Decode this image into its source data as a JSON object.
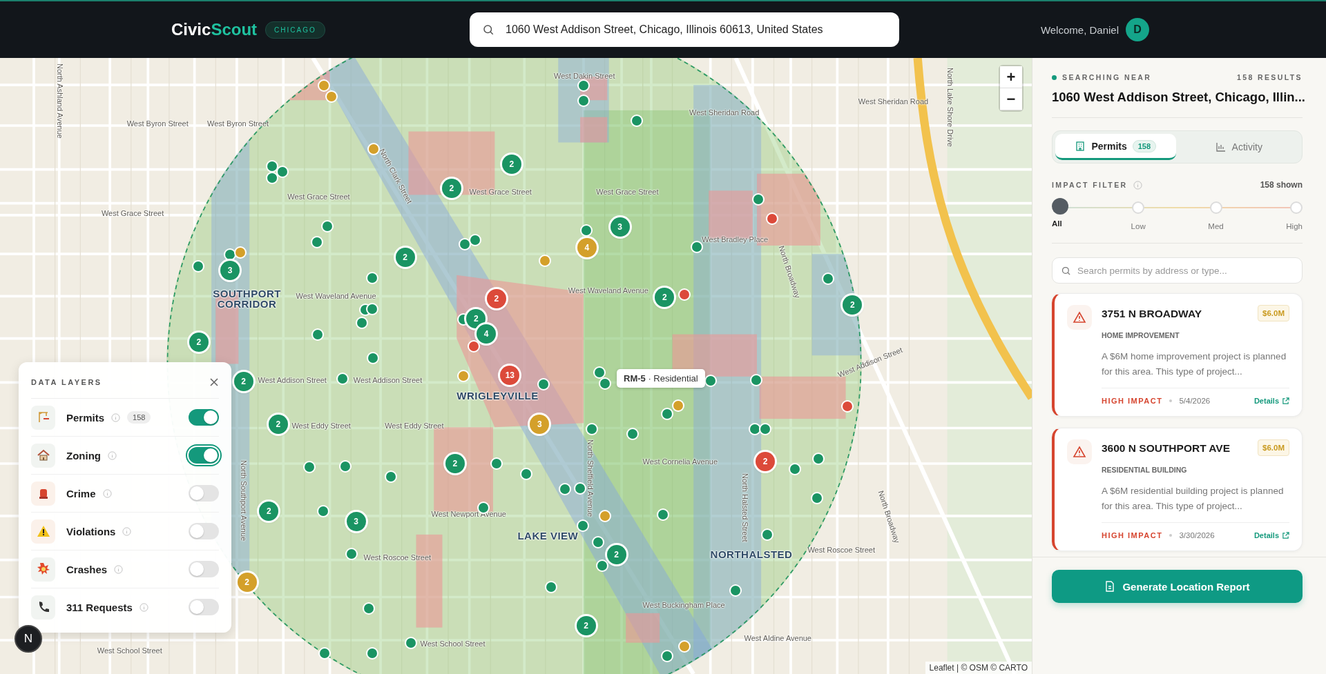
{
  "header": {
    "logo": [
      "Civic",
      "Scout"
    ],
    "city_badge": "CHICAGO",
    "search": {
      "value": "1060 West Addison Street, Chicago, Illinois 60613, United States"
    },
    "welcome": "Welcome, Daniel",
    "avatar": "D"
  },
  "map": {
    "labels": [
      {
        "text": "West Byron Street",
        "kind": "street"
      },
      {
        "text": "West Byron Street",
        "kind": "street"
      },
      {
        "text": "West Grace Street",
        "kind": "street"
      },
      {
        "text": "West Grace Street",
        "kind": "street"
      },
      {
        "text": "West Grace Street",
        "kind": "street"
      },
      {
        "text": "West Grace Street",
        "kind": "street"
      },
      {
        "text": "West Sheridan Road",
        "kind": "street"
      },
      {
        "text": "West Sheridan Road",
        "kind": "street"
      },
      {
        "text": "West Dakin Street",
        "kind": "street"
      },
      {
        "text": "West Waveland Avenue",
        "kind": "street"
      },
      {
        "text": "West Waveland Avenue",
        "kind": "street"
      },
      {
        "text": "West Addison Street",
        "kind": "street"
      },
      {
        "text": "West Addison Street",
        "kind": "street"
      },
      {
        "text": "West Addison Street",
        "kind": "street"
      },
      {
        "text": "West Eddy Street",
        "kind": "street"
      },
      {
        "text": "West Eddy Street",
        "kind": "street"
      },
      {
        "text": "West Cornelia Avenue",
        "kind": "street"
      },
      {
        "text": "West Newport Avenue",
        "kind": "street"
      },
      {
        "text": "West Roscoe Street",
        "kind": "street"
      },
      {
        "text": "West Roscoe Street",
        "kind": "street"
      },
      {
        "text": "West Buckingham Place",
        "kind": "street"
      },
      {
        "text": "West Aldine Avenue",
        "kind": "street"
      },
      {
        "text": "West School Street",
        "kind": "street"
      },
      {
        "text": "West School Street",
        "kind": "street"
      },
      {
        "text": "West Bradley Place",
        "kind": "street"
      },
      {
        "text": "SOUTHPORT CORRIDOR",
        "kind": "neighborhood"
      },
      {
        "text": "WRIGLEYVILLE",
        "kind": "neighborhood"
      },
      {
        "text": "LAKE VIEW",
        "kind": "neighborhood"
      },
      {
        "text": "NORTHALSTED",
        "kind": "neighborhood"
      },
      {
        "text": "North Ashland Avenue",
        "kind": "street"
      },
      {
        "text": "North Clark Street",
        "kind": "street"
      },
      {
        "text": "North Sheffield Avenue",
        "kind": "street"
      },
      {
        "text": "North Halsted Street",
        "kind": "street"
      },
      {
        "text": "North Broadway",
        "kind": "street"
      },
      {
        "text": "North Lake Shore Drive",
        "kind": "street"
      },
      {
        "text": "North Southport Avenue",
        "kind": "street"
      },
      {
        "text": "North Broadway",
        "kind": "street"
      }
    ],
    "markers": [
      {
        "count": "2",
        "color": "#1a9463"
      },
      {
        "count": "2",
        "color": "#1a9463"
      },
      {
        "count": "3",
        "color": "#1a9463"
      },
      {
        "count": "2",
        "color": "#1a9463"
      },
      {
        "count": "3",
        "color": "#1a9463"
      },
      {
        "count": "2",
        "color": "#1a9463"
      },
      {
        "count": "4",
        "color": "#1a9463"
      },
      {
        "count": "2",
        "color": "#1a9463"
      },
      {
        "count": "2",
        "color": "#1a9463"
      },
      {
        "count": "2",
        "color": "#1a9463"
      },
      {
        "count": "2",
        "color": "#1a9463"
      },
      {
        "count": "2",
        "color": "#1a9463"
      },
      {
        "count": "2",
        "color": "#1a9463"
      },
      {
        "count": "3",
        "color": "#1a9463"
      },
      {
        "count": "2",
        "color": "#1a9463"
      },
      {
        "count": "2",
        "color": "#1a9463"
      },
      {
        "count": "2",
        "color": "#1a9463"
      },
      {
        "count": "2",
        "color": "#dc4a3a"
      },
      {
        "count": "13",
        "color": "#dc4a3a"
      },
      {
        "count": "2",
        "color": "#dc4a3a"
      },
      {
        "count": "4",
        "color": "#d4a02a"
      },
      {
        "count": "3",
        "color": "#d4a02a"
      },
      {
        "count": "2",
        "color": "#d4a02a"
      }
    ],
    "dots": [
      {
        "color": "#1a9463"
      },
      {
        "color": "#1a9463"
      },
      {
        "color": "#1a9463"
      },
      {
        "color": "#1a9463"
      },
      {
        "color": "#1a9463"
      },
      {
        "color": "#1a9463"
      },
      {
        "color": "#1a9463"
      },
      {
        "color": "#1a9463"
      },
      {
        "color": "#1a9463"
      },
      {
        "color": "#1a9463"
      },
      {
        "color": "#1a9463"
      },
      {
        "color": "#1a9463"
      },
      {
        "color": "#1a9463"
      },
      {
        "color": "#1a9463"
      },
      {
        "color": "#1a9463"
      },
      {
        "color": "#1a9463"
      },
      {
        "color": "#1a9463"
      },
      {
        "color": "#1a9463"
      },
      {
        "color": "#1a9463"
      },
      {
        "color": "#1a9463"
      },
      {
        "color": "#1a9463"
      },
      {
        "color": "#1a9463"
      },
      {
        "color": "#1a9463"
      },
      {
        "color": "#1a9463"
      },
      {
        "color": "#1a9463"
      },
      {
        "color": "#1a9463"
      },
      {
        "color": "#1a9463"
      },
      {
        "color": "#1a9463"
      },
      {
        "color": "#1a9463"
      },
      {
        "color": "#1a9463"
      },
      {
        "color": "#1a9463"
      },
      {
        "color": "#1a9463"
      },
      {
        "color": "#1a9463"
      },
      {
        "color": "#1a9463"
      },
      {
        "color": "#1a9463"
      },
      {
        "color": "#1a9463"
      },
      {
        "color": "#1a9463"
      },
      {
        "color": "#1a9463"
      },
      {
        "color": "#1a9463"
      },
      {
        "color": "#1a9463"
      },
      {
        "color": "#1a9463"
      },
      {
        "color": "#1a9463"
      },
      {
        "color": "#1a9463"
      },
      {
        "color": "#1a9463"
      },
      {
        "color": "#1a9463"
      },
      {
        "color": "#1a9463"
      },
      {
        "color": "#1a9463"
      },
      {
        "color": "#1a9463"
      },
      {
        "color": "#1a9463"
      },
      {
        "color": "#1a9463"
      },
      {
        "color": "#1a9463"
      },
      {
        "color": "#1a9463"
      },
      {
        "color": "#1a9463"
      },
      {
        "color": "#1a9463"
      },
      {
        "color": "#1a9463"
      },
      {
        "color": "#1a9463"
      },
      {
        "color": "#1a9463"
      },
      {
        "color": "#1a9463"
      },
      {
        "color": "#1a9463"
      },
      {
        "color": "#d4a02a"
      },
      {
        "color": "#d4a02a"
      },
      {
        "color": "#d4a02a"
      },
      {
        "color": "#d4a02a"
      },
      {
        "color": "#d4a02a"
      },
      {
        "color": "#d4a02a"
      },
      {
        "color": "#d4a02a"
      },
      {
        "color": "#d4a02a"
      },
      {
        "color": "#d4a02a"
      },
      {
        "color": "#dc4a3a"
      },
      {
        "color": "#dc4a3a"
      },
      {
        "color": "#dc4a3a"
      },
      {
        "color": "#dc4a3a"
      }
    ],
    "tooltip": "**RM-5** · Residential",
    "zoom_in": "+",
    "zoom_out": "−",
    "attribution": "Leaflet | © OSM © CARTO"
  },
  "data_layers": {
    "title": "DATA LAYERS",
    "items": [
      {
        "label": "Permits",
        "count": "158",
        "on": true,
        "kind": "permits"
      },
      {
        "label": "Zoning",
        "on": true,
        "kind": "zoning"
      },
      {
        "label": "Crime",
        "on": false,
        "kind": "crime"
      },
      {
        "label": "Violations",
        "on": false,
        "kind": "violations"
      },
      {
        "label": "Crashes",
        "on": false,
        "kind": "crashes"
      },
      {
        "label": "311 Requests",
        "on": false,
        "kind": "requests"
      }
    ]
  },
  "dev_button": "N",
  "panel": {
    "searching_label": "SEARCHING NEAR",
    "results": "158 RESULTS",
    "address": "1060 West Addison Street, Chicago, Illin...",
    "tabs": [
      {
        "label": "Permits",
        "badge": "158",
        "selected": true,
        "kind": "permits"
      },
      {
        "label": "Activity",
        "selected": false,
        "kind": "activity"
      }
    ],
    "filter": {
      "label": "IMPACT FILTER",
      "shown": "158 shown",
      "stops": [
        {
          "label": "All",
          "selected": true
        },
        {
          "label": "Low",
          "selected": false
        },
        {
          "label": "Med",
          "selected": false
        },
        {
          "label": "High",
          "selected": false
        }
      ]
    },
    "search_placeholder": "Search permits by address or type...",
    "permits": [
      {
        "address": "3751 N BROADWAY",
        "amount": "$6.0M",
        "category": "HOME IMPROVEMENT",
        "description": "A $6M home improvement project is planned for this area. This type of project...",
        "impact": "HIGH IMPACT",
        "kind": "high",
        "date": "5/4/2026",
        "link": "Details"
      },
      {
        "address": "3600 N SOUTHPORT AVE",
        "amount": "$6.0M",
        "category": "RESIDENTIAL BUILDING",
        "description": "A $6M residential building project is planned for this area. This type of project...",
        "impact": "HIGH IMPACT",
        "kind": "high",
        "date": "3/30/2026",
        "link": "Details"
      }
    ],
    "report_button": "Generate Location Report"
  }
}
